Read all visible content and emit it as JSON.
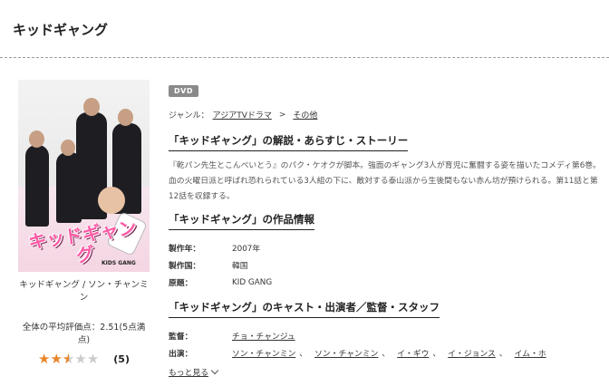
{
  "page": {
    "title": "キッドギャング"
  },
  "sidebar": {
    "cover_logo": "キッドギャング",
    "cover_sub": "KIDS GANG",
    "caption": "キッドギャング / ソン・チャンミン",
    "rating_label": "全体の平均評価点：2.51(5点満点)",
    "rating_value": 2.5,
    "rating_max": 5,
    "review_count": "(5)"
  },
  "main": {
    "badge": "DVD",
    "genre": {
      "label": "ジャンル：",
      "primary": "アジアTVドラマ",
      "separator": ">",
      "secondary": "その他"
    },
    "synopsis": {
      "heading": "「キッドギャング」の解説・あらすじ・ストーリー",
      "text": "『乾パン先生とこんぺいとう』のパク・ケオクが脚本。強面のギャング3人が育児に奮闘する姿を描いたコメディ第6巻。血の火曜日派と呼ばれ恐れられている3人組の下に、敵対する泰山派から生後間もない赤ん坊が預けられる。第11話と第12話を収録する。"
    },
    "info": {
      "heading": "「キッドギャング」の作品情報",
      "rows": [
        {
          "key": "製作年：",
          "value": "2007年"
        },
        {
          "key": "製作国：",
          "value": "韓国"
        },
        {
          "key": "原題：",
          "value": "KID GANG"
        }
      ]
    },
    "cast": {
      "heading": "「キッドギャング」のキャスト・出演者／監督・スタッフ",
      "director_key": "監督：",
      "director": "チョ・チャンジュ",
      "cast_key": "出演：",
      "cast": [
        "ソン・チャンミン",
        "ソン・チャンミン",
        "イ・ギウ",
        "イ・ジョンス",
        "イム・ホ"
      ],
      "comma": "、",
      "more": "もっと見る"
    }
  },
  "colors": {
    "star": "#e8862a",
    "badge": "#8a8a8a"
  }
}
